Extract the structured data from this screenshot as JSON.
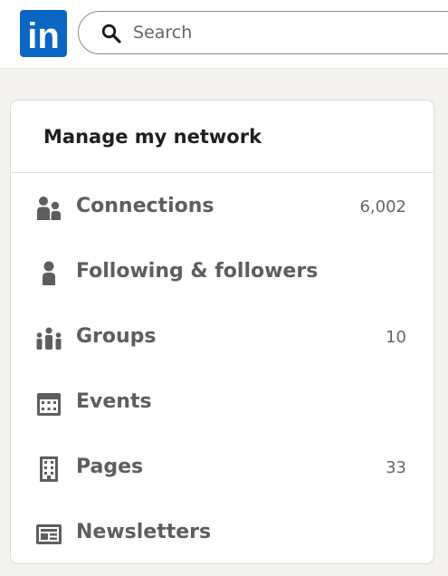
{
  "header": {
    "logo_text": "in",
    "search_placeholder": "Search"
  },
  "network": {
    "title": "Manage my network",
    "items": [
      {
        "label": "Connections",
        "count": "6,002",
        "icon": "people-icon"
      },
      {
        "label": "Following & followers",
        "count": "",
        "icon": "person-icon"
      },
      {
        "label": "Groups",
        "count": "10",
        "icon": "group-icon"
      },
      {
        "label": "Events",
        "count": "",
        "icon": "calendar-icon"
      },
      {
        "label": "Pages",
        "count": "33",
        "icon": "building-icon"
      },
      {
        "label": "Newsletters",
        "count": "",
        "icon": "newspaper-icon"
      }
    ]
  },
  "colors": {
    "brand": "#0a66c2",
    "background": "#f4f2ee",
    "text_muted": "#5e5e5e"
  }
}
